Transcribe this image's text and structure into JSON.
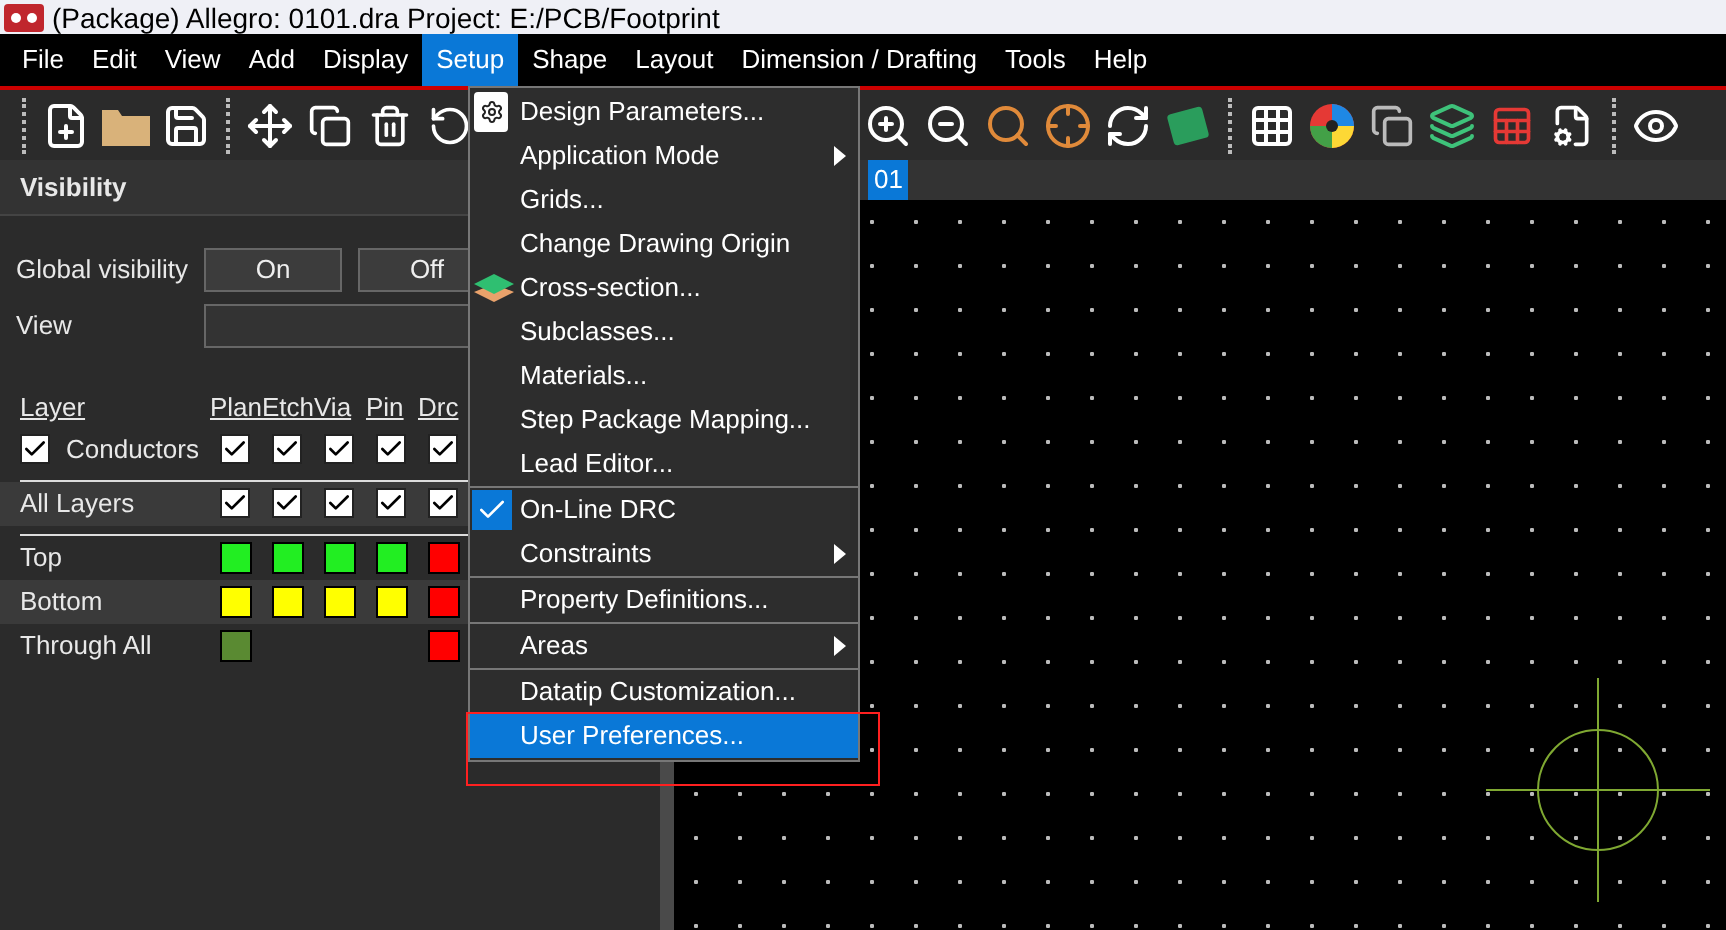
{
  "window": {
    "title": "(Package) Allegro: 0101.dra  Project: E:/PCB/Footprint"
  },
  "menu_bar": [
    {
      "label": "File",
      "selected": false
    },
    {
      "label": "Edit",
      "selected": false
    },
    {
      "label": "View",
      "selected": false
    },
    {
      "label": "Add",
      "selected": false
    },
    {
      "label": "Display",
      "selected": false
    },
    {
      "label": "Setup",
      "selected": true
    },
    {
      "label": "Shape",
      "selected": false
    },
    {
      "label": "Layout",
      "selected": false
    },
    {
      "label": "Dimension / Drafting",
      "selected": false
    },
    {
      "label": "Tools",
      "selected": false
    },
    {
      "label": "Help",
      "selected": false
    }
  ],
  "visibility_panel": {
    "title": "Visibility",
    "global_visibility_label": "Global visibility",
    "buttons": [
      "On",
      "Off"
    ],
    "view_label": "View",
    "layer_headers": [
      "Layer",
      "Plan",
      "Etch",
      "Via",
      "Pin",
      "Drc"
    ],
    "rows": [
      {
        "kind": "check",
        "label": "Conductors",
        "checked": true,
        "cells": [
          {
            "checked": true
          },
          {
            "checked": true
          },
          {
            "checked": true
          },
          {
            "checked": true
          },
          {
            "checked": true
          }
        ]
      },
      {
        "kind": "check",
        "label": "All Layers",
        "cells": [
          {
            "checked": true
          },
          {
            "checked": true
          },
          {
            "checked": true
          },
          {
            "checked": true
          },
          {
            "checked": true
          }
        ]
      },
      {
        "kind": "color",
        "label": "Top",
        "cells": [
          {
            "color": "#22ee22"
          },
          {
            "color": "#22ee22"
          },
          {
            "color": "#22ee22"
          },
          {
            "color": "#22ee22"
          },
          {
            "color": "#ff0000"
          }
        ]
      },
      {
        "kind": "color",
        "label": "Bottom",
        "cells": [
          {
            "color": "#ffff00"
          },
          {
            "color": "#ffff00"
          },
          {
            "color": "#ffff00"
          },
          {
            "color": "#ffff00"
          },
          {
            "color": "#ff0000"
          }
        ]
      },
      {
        "kind": "color",
        "label": "Through All",
        "cells": [
          {
            "color": "#5a8a32"
          },
          null,
          null,
          null,
          {
            "color": "#ff0000"
          }
        ]
      }
    ]
  },
  "canvas_tab": {
    "label": "01",
    "selected": true
  },
  "setup_menu": [
    {
      "label": "Design Parameters...",
      "kind": "item",
      "selected": false
    },
    {
      "label": "Application Mode",
      "kind": "submenu",
      "selected": false
    },
    {
      "label": "Grids...",
      "kind": "item",
      "selected": false
    },
    {
      "label": "Change Drawing Origin",
      "kind": "item",
      "selected": false
    },
    {
      "label": "Cross-section...",
      "kind": "item",
      "selected": false
    },
    {
      "label": "Subclasses...",
      "kind": "item",
      "selected": false
    },
    {
      "label": "Materials...",
      "kind": "item",
      "selected": false
    },
    {
      "label": "Step Package Mapping...",
      "kind": "item",
      "selected": false
    },
    {
      "label": "Lead Editor...",
      "kind": "item",
      "selected": false
    },
    {
      "label": "On-Line DRC",
      "kind": "check",
      "checked": true,
      "separator_before": true,
      "selected": false
    },
    {
      "label": "Constraints",
      "kind": "submenu",
      "selected": false
    },
    {
      "label": "Property Definitions...",
      "kind": "item",
      "separator_before": true,
      "selected": false
    },
    {
      "label": "Areas",
      "kind": "submenu",
      "separator_before": true,
      "selected": false
    },
    {
      "label": "Datatip Customization...",
      "kind": "item",
      "separator_before": true,
      "selected": false
    },
    {
      "label": "User Preferences...",
      "kind": "item",
      "selected": true
    }
  ]
}
